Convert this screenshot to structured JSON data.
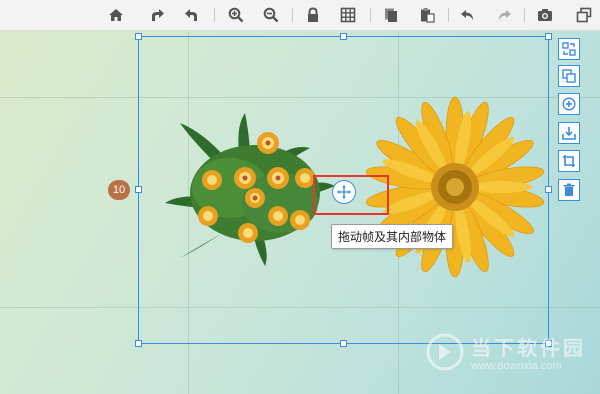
{
  "toolbar": {
    "buttons": [
      {
        "name": "home-icon"
      },
      {
        "name": "redo-arrow-icon"
      },
      {
        "name": "undo-arrow-icon"
      },
      {
        "name": "zoom-in-icon"
      },
      {
        "name": "zoom-out-icon"
      },
      {
        "name": "lock-icon"
      },
      {
        "name": "grid-icon"
      },
      {
        "name": "copy-icon"
      },
      {
        "name": "paste-icon"
      },
      {
        "name": "undo-icon"
      },
      {
        "name": "redo-icon"
      },
      {
        "name": "camera-icon"
      },
      {
        "name": "window-icon"
      }
    ]
  },
  "sidebar": {
    "buttons": [
      {
        "name": "replace-icon"
      },
      {
        "name": "duplicate-icon"
      },
      {
        "name": "add-icon"
      },
      {
        "name": "save-icon"
      },
      {
        "name": "crop-icon"
      },
      {
        "name": "delete-icon"
      }
    ]
  },
  "frame": {
    "badge": "10",
    "tooltip": "拖动帧及其内部物体"
  },
  "watermark": {
    "title": "当下软件园",
    "url": "www.downxia.com"
  },
  "colors": {
    "accent": "#3a8de0",
    "highlight": "#e8362b",
    "badge": "#b87345"
  }
}
